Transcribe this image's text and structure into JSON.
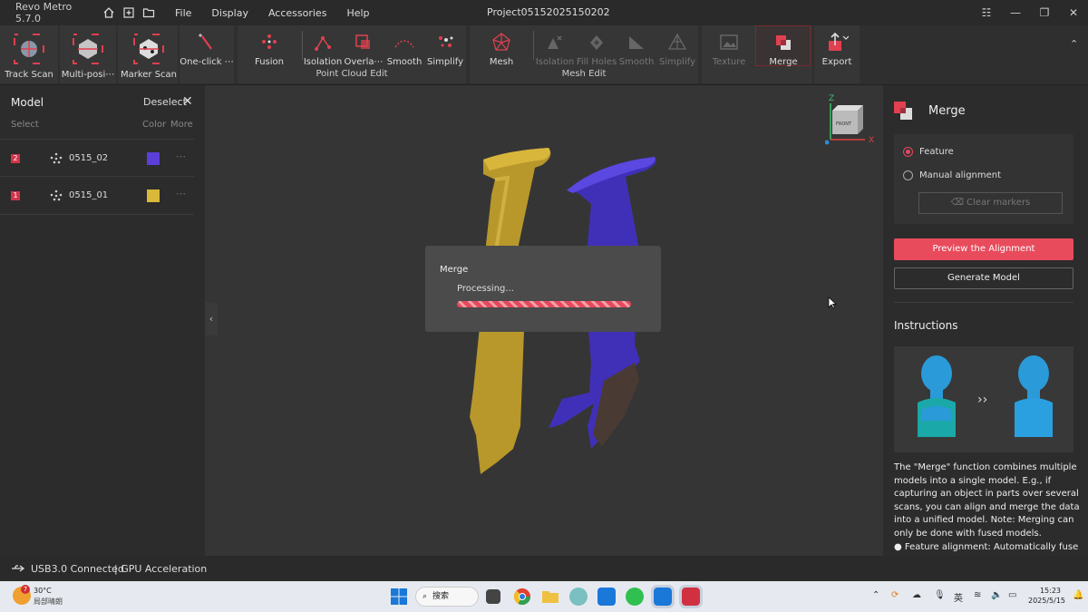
{
  "app": {
    "name": "Revo Metro 5.7.0",
    "project": "Project05152025150202",
    "menu": [
      "File",
      "Display",
      "Accessories",
      "Help"
    ]
  },
  "toolbar": {
    "track_scan": "Track Scan",
    "multi_position": "Multi-posi⋯",
    "marker_scan": "Marker Scan",
    "one_click": "One-click ⋯",
    "fusion": "Fusion",
    "pc_isolation": "Isolation",
    "overlap": "Overla⋯",
    "pc_smooth": "Smooth",
    "pc_simplify": "Simplify",
    "point_cloud_edit": "Point Cloud Edit",
    "mesh": "Mesh",
    "mesh_isolation": "Isolation",
    "fill_holes": "Fill Holes",
    "mesh_smooth": "Smooth",
    "mesh_simplify": "Simplify",
    "mesh_edit": "Mesh Edit",
    "texture": "Texture",
    "merge": "Merge",
    "export": "Export"
  },
  "left_panel": {
    "title": "Model",
    "deselect": "Deselect",
    "col_select": "Select",
    "col_color": "Color",
    "col_more": "More",
    "models": [
      {
        "index": "2",
        "name": "0515_02",
        "color": "#5b3fd8"
      },
      {
        "index": "1",
        "name": "0515_01",
        "color": "#d9b83a"
      }
    ]
  },
  "dialog": {
    "title": "Merge",
    "status": "Processing..."
  },
  "gizmo": {
    "z": "Z",
    "x": "X",
    "face": "FRONT"
  },
  "right_panel": {
    "title": "Merge",
    "option_feature": "Feature",
    "option_manual": "Manual alignment",
    "clear_markers": "Clear markers",
    "preview_button": "Preview the Alignment",
    "generate_button": "Generate Model",
    "instructions_title": "Instructions",
    "arrow": "››",
    "description": "The \"Merge\" function combines multiple models into a single model. E.g., if capturing an object in parts over several scans, you can align and merge the data into a unified model. Note: Merging can only be done with fused models.",
    "description2": "● Feature alignment: Automatically fuse"
  },
  "status_bar": {
    "usb": "USB3.0 Connected",
    "gpu": "| GPU Acceleration"
  },
  "taskbar": {
    "weather_badge": "7",
    "temperature": "30°C",
    "weather_desc": "局部晴朗",
    "search": "搜索",
    "ime": "英",
    "time": "15:23",
    "date": "2025/5/15"
  },
  "colors": {
    "accent": "#e84b5c",
    "model_blue": "#5b3fd8",
    "model_yellow": "#d9b83a"
  }
}
